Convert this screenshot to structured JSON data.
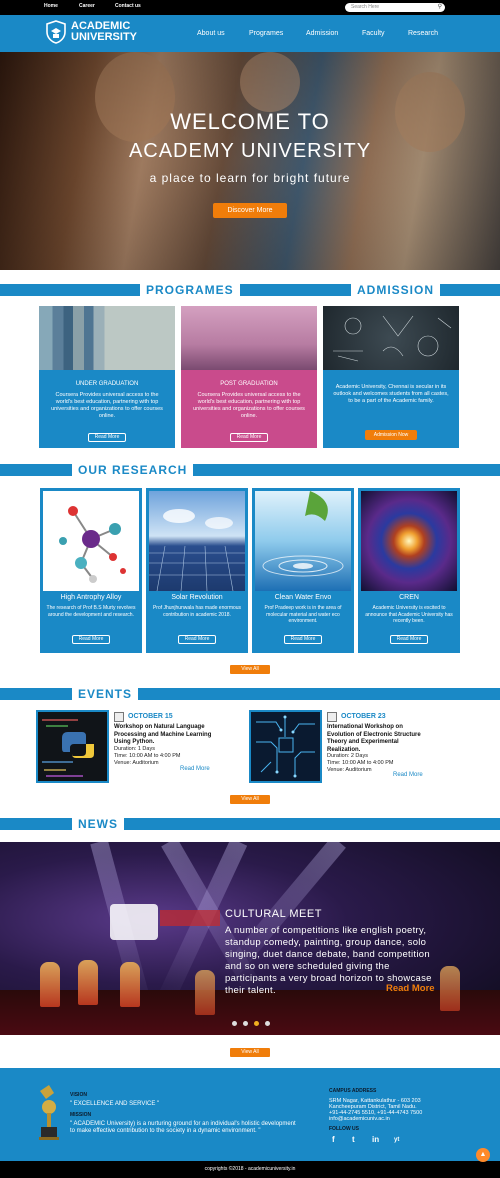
{
  "topbar": {
    "links": [
      "Home",
      "Career",
      "Contact us"
    ],
    "search_placeholder": "Search Here"
  },
  "nav": {
    "brand_line1": "ACADEMIC",
    "brand_line2": "UNIVERSITY",
    "items": [
      "About us",
      "Programes",
      "Admission",
      "Faculty",
      "Research"
    ]
  },
  "hero": {
    "line1": "WELCOME TO",
    "line2": "ACADEMY UNIVERSITY",
    "tagline": "a place to learn for bright future",
    "button": "Discover More"
  },
  "programes": {
    "heading": "PROGRAMES",
    "admission_heading": "ADMISSION",
    "cards": [
      {
        "title": "UNDER GRADUATION",
        "text": "Coursera Provides universal access to the world's best education, partnering with top universities and organizations to offer courses online.",
        "button": "Read More"
      },
      {
        "title": "POST GRADUATION",
        "text": "Coursera Provides universal access to the world's best education, partnering with top universities and organizations to offer courses online.",
        "button": "Read More"
      },
      {
        "title": "",
        "text": "Academic University, Chennai is secular in its outlook and welcomes students from all castes, to be a part of the Academic family.",
        "button": "Admission Now"
      }
    ],
    "colors": {
      "blue": "#1a89c6",
      "pink": "#c94b8c",
      "orange": "#f07d0a"
    }
  },
  "research": {
    "heading": "OUR RESEARCH",
    "cards": [
      {
        "title": "High Antrophy Alloy",
        "text": "The research of Prof B.S Murty revolves around the development and research.",
        "button": "Read More"
      },
      {
        "title": "Solar Revolution",
        "text": "Prof Jhunjhunwala has made enormous contribution in academic 2018.",
        "button": "Read More"
      },
      {
        "title": "Clean Water Envo",
        "text": "Prof Pradeep work is in the area of molecular material and water eco environment.",
        "button": "Read More"
      },
      {
        "title": "CREN",
        "text": "Academic University is excited to announce that Academic University has recently been.",
        "button": "Read More"
      }
    ],
    "view_all": "View All"
  },
  "events": {
    "heading": "EVENTS",
    "items": [
      {
        "date": "OCTOBER 15",
        "title": "Workshop on Natural Language Processing and Machine Learning Using Python.",
        "duration": "Duration: 1 Days",
        "time": "Time: 10:00 AM to 4:00 PM",
        "venue": "Venue: Auditorium",
        "more": "Read More"
      },
      {
        "date": "OCTOBER 23",
        "title": "International Workshop on Evolution of Electronic Structure Theory and Experimental Realization.",
        "duration": "Duration: 2 Days",
        "time": "Time: 10:00 AM to 4:00 PM",
        "venue": "Venue: Auditorium",
        "more": "Read More"
      }
    ],
    "view_all": "View All"
  },
  "news": {
    "heading": "NEWS",
    "title": "CULTURAL MEET",
    "text": "A number of competitions like english poetry, standup comedy, painting, group dance, solo singing, duet dance debate, band competition and so on were scheduled giving the participants a very broad horizon to showcase their talent.",
    "more": "Read More",
    "view_all": "View All"
  },
  "footer": {
    "vision_label": "VISION",
    "vision_text": "\" EXCELLENCE AND SERVICE \"",
    "mission_label": "MISSION",
    "mission_text": "\" ACADEMIC University) is a nurturing ground for an individual's holistic development to make effective contribution to the society in a dynamic environment. \"",
    "campus_label": "CAMPUS ADDRESS",
    "address_line1": "SRM Nagar, Kattankulathur - 603 203",
    "address_line2": "Kancheepuram District, Tamil Nadu.",
    "address_line3": "+91-44-2745 5510, +91-44-4743 7500",
    "address_line4": "info@academicuniv.ac.in",
    "follow_label": "FOLLOW US",
    "social": [
      "f",
      "t",
      "in",
      "yt"
    ],
    "copyright": "copyrights ©2018 - academicuniversity.in"
  }
}
